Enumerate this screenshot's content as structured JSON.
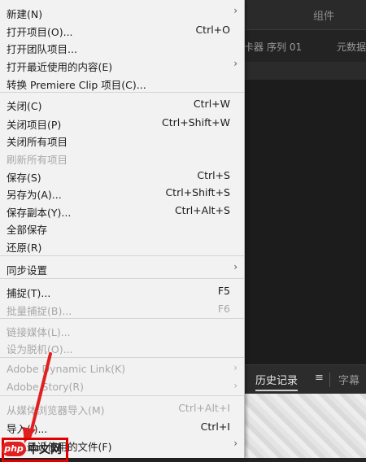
{
  "background": {
    "title": "组件",
    "sub_items": [
      "卡器",
      "序列 01",
      "元数据"
    ],
    "tabs": {
      "history": "历史记录",
      "menu_icon": "≡",
      "partial": "字幕"
    }
  },
  "menu": {
    "items": [
      {
        "label": "新建(N)",
        "shortcut": "",
        "submenu": true,
        "disabled": false
      },
      {
        "label": "打开项目(O)...",
        "shortcut": "Ctrl+O",
        "submenu": false,
        "disabled": false
      },
      {
        "label": "打开团队项目...",
        "shortcut": "",
        "submenu": false,
        "disabled": false
      },
      {
        "label": "打开最近使用的内容(E)",
        "shortcut": "",
        "submenu": true,
        "disabled": false
      },
      {
        "label": "转换 Premiere Clip 项目(C)...",
        "shortcut": "",
        "submenu": false,
        "disabled": false
      },
      {
        "label": "关闭(C)",
        "shortcut": "Ctrl+W",
        "submenu": false,
        "disabled": false
      },
      {
        "label": "关闭项目(P)",
        "shortcut": "Ctrl+Shift+W",
        "submenu": false,
        "disabled": false
      },
      {
        "label": "关闭所有项目",
        "shortcut": "",
        "submenu": false,
        "disabled": false
      },
      {
        "label": "刷新所有项目",
        "shortcut": "",
        "submenu": false,
        "disabled": true
      },
      {
        "label": "保存(S)",
        "shortcut": "Ctrl+S",
        "submenu": false,
        "disabled": false
      },
      {
        "label": "另存为(A)...",
        "shortcut": "Ctrl+Shift+S",
        "submenu": false,
        "disabled": false
      },
      {
        "label": "保存副本(Y)...",
        "shortcut": "Ctrl+Alt+S",
        "submenu": false,
        "disabled": false
      },
      {
        "label": "全部保存",
        "shortcut": "",
        "submenu": false,
        "disabled": false
      },
      {
        "label": "还原(R)",
        "shortcut": "",
        "submenu": false,
        "disabled": false
      },
      {
        "label": "同步设置",
        "shortcut": "",
        "submenu": true,
        "disabled": false
      },
      {
        "label": "捕捉(T)...",
        "shortcut": "F5",
        "submenu": false,
        "disabled": false
      },
      {
        "label": "批量捕捉(B)...",
        "shortcut": "F6",
        "submenu": false,
        "disabled": true
      },
      {
        "label": "链接媒体(L)...",
        "shortcut": "",
        "submenu": false,
        "disabled": true
      },
      {
        "label": "设为脱机(O)...",
        "shortcut": "",
        "submenu": false,
        "disabled": true
      },
      {
        "label": "Adobe Dynamic Link(K)",
        "shortcut": "",
        "submenu": true,
        "disabled": true
      },
      {
        "label": "Adobe Story(R)",
        "shortcut": "",
        "submenu": true,
        "disabled": true
      },
      {
        "label": "从媒体浏览器导入(M)",
        "shortcut": "Ctrl+Alt+I",
        "submenu": false,
        "disabled": true
      },
      {
        "label": "导入(I)...",
        "shortcut": "Ctrl+I",
        "submenu": false,
        "disabled": false
      },
      {
        "label": "导入最近使用的文件(F)",
        "shortcut": "",
        "submenu": true,
        "disabled": false
      }
    ]
  },
  "watermark": {
    "logo": "php",
    "text": "中文网"
  },
  "colors": {
    "highlight_box": "#e00000",
    "arrow": "#e02020"
  }
}
